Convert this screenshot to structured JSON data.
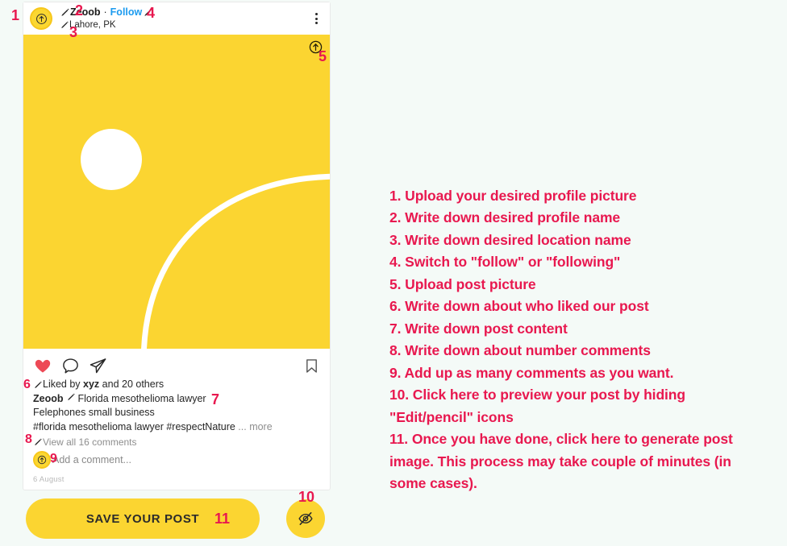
{
  "theme": {
    "page_background": "#F4FAF7",
    "accent_yellow": "#FBD531",
    "annotation_pink": "#E8184F",
    "follow_blue": "#1C9BEF",
    "heart_red": "#ED4956",
    "muted_gray": "#8E8E8E"
  },
  "post": {
    "avatar_icon": "upload-circle-icon",
    "profile_name": "Zeoob",
    "separator": "·",
    "follow_label": "Follow",
    "location": "Lahore, PK",
    "menu_icon": "more-options-icon",
    "image": {
      "upload_icon": "upload-circle-icon",
      "background_color": "#FBD531",
      "shapes": "white-circle-and-arc"
    },
    "actions": {
      "like_icon": "heart-icon",
      "comment_icon": "comment-bubble-icon",
      "share_icon": "paper-plane-icon",
      "save_icon": "bookmark-icon"
    },
    "likes": {
      "prefix": "Liked by ",
      "user": "xyz",
      "suffix": " and 20 others"
    },
    "caption": {
      "username": "Zeoob",
      "line1": "Florida mesothelioma lawyer",
      "line2": "Felephones small business",
      "line3": "#florida mesothelioma lawyer #respectNature",
      "more": "... more"
    },
    "view_comments": "View all 16 comments",
    "comment_placeholder": "Add a comment...",
    "date": "6 August"
  },
  "controls": {
    "save_label": "SAVE YOUR POST",
    "preview_icon": "eye-slash-icon"
  },
  "instructions": [
    "1. Upload your desired profile picture",
    "2. Write down desired profile name",
    "3. Write down desired location name",
    "4. Switch to \"follow\" or \"following\"",
    "5. Upload post picture",
    "6. Write down about who liked our post",
    "7. Write down post content",
    "8. Write down about number comments",
    "9. Add up as many comments as you want.",
    "10. Click here to preview your post by hiding \"Edit/pencil\" icons",
    "11. Once you have done, click here to generate post image. This process may take couple of minutes (in some cases)."
  ],
  "markers": {
    "m1": "1",
    "m2": "2",
    "m3": "3",
    "m4": "4",
    "m5": "5",
    "m6": "6",
    "m7": "7",
    "m8": "8",
    "m9": "9",
    "m10": "10",
    "m11": "11"
  }
}
